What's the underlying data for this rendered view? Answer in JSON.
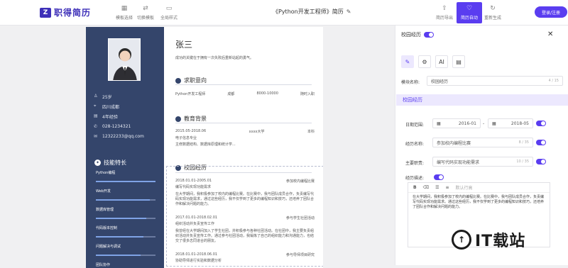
{
  "app": {
    "logo_mark": "Z",
    "logo_text": "职得简历",
    "doc_title": "《Python开发工程师》简历",
    "login": "登录/注册"
  },
  "toolbar": {
    "tools": [
      {
        "icon": "▦",
        "label": "模板选择"
      },
      {
        "icon": "⇄",
        "label": "切换模板"
      },
      {
        "icon": "▭",
        "label": "全局样式"
      }
    ],
    "right": [
      {
        "icon": "⇪",
        "label": "简历导出"
      },
      {
        "icon": "♡",
        "label": "简历自动"
      },
      {
        "icon": "↻",
        "label": "重新生成"
      }
    ]
  },
  "resume": {
    "name": "张三",
    "intro": "成功的关键在于拥有一次失败后重新站起的勇气。",
    "info": [
      {
        "icon": "♙",
        "text": "25岁"
      },
      {
        "icon": "⌖",
        "text": "四川成都"
      },
      {
        "icon": "▤",
        "text": "4年经验"
      },
      {
        "icon": "✆",
        "text": "028-1234321"
      },
      {
        "icon": "✉",
        "text": "12322233@qq.com"
      }
    ],
    "skills_title": "技能特长",
    "skills": [
      {
        "name": "Python编程",
        "level": 1.0
      },
      {
        "name": "Web开发",
        "level": 0.9
      },
      {
        "name": "数据库管理",
        "level": 0.85
      },
      {
        "name": "代码版本控制",
        "level": 0.8
      },
      {
        "name": "问题解决与调试",
        "level": 0.75
      },
      {
        "name": "团队协作",
        "level": 0.7
      }
    ],
    "sections": {
      "intent": {
        "title": "求职意向",
        "items": [
          "Python开发工程师",
          "成都",
          "8000-10000",
          "随时入职"
        ]
      },
      "education": {
        "title": "教育背景",
        "date": "2015.05-2018.06",
        "school": "xxxx大学",
        "degree": "本科",
        "major": "电子信息专业",
        "courses": "主修数据结构、数据库原理和统计学..."
      },
      "campus": {
        "title": "校园经历",
        "entries": [
          {
            "date": "2018.01.01-2005.01",
            "role": "参加校内编程比赛",
            "sub": "编写代码实现功能需求",
            "text": "在大学期间，我积极参加了校内的编程比赛。在比赛中，我与团队成员合作，负责编写代码实现功能需求，通过这些经历，我不仅学到了更多的编程知识和技巧，还培养了团队合作和解决问题的能力。"
          },
          {
            "date": "2017.01.01-2018.02.01",
            "role": "参与学生社团活动",
            "sub": "组织活动并负责宣传工作",
            "text": "我曾经在大学期间加入了学生社团，并积极参与各种社团活动。在社团中，我主要负责组织活动并负责宣传工作。通过参与社团活动，我锻炼了自己的组织能力和沟通能力，也结交了很多志同道合的朋友。"
          },
          {
            "date": "2018.01.01-2018.06.01",
            "role": "参与导师项目研究",
            "sub": "协助导师进行实验和数据分析",
            "text": ""
          }
        ]
      }
    }
  },
  "panel": {
    "title": "校园经历",
    "tabs": [
      {
        "icon": "✎"
      },
      {
        "icon": "⚙"
      },
      {
        "icon": "AI"
      },
      {
        "icon": "▤"
      }
    ],
    "module_name_label": "模块名称:",
    "module_name_value": "校园经历",
    "module_name_count": "4 / 15",
    "band_title": "校园经历",
    "date_label": "日期范围:",
    "date_start": "2016-01",
    "date_sep": "-",
    "date_end": "2018-05",
    "exp_label": "经历名称:",
    "exp_value": "参加校内编程比赛",
    "exp_count": "8 / 35",
    "duty_label": "主要职责:",
    "duty_value": "编写代码实现功能需求",
    "duty_count": "10 / 35",
    "desc_label": "经历描述:",
    "editor_placeholder": "默认行高",
    "editor_text": "在大学期间，我积极参加了校内的编程比赛。在比赛中，我与团队成员合作，负责编写代码实现功能需求。通过这些经历，我不仅学到了更多的编程知识和技巧，还培养了团队合作和解决问题的能力。"
  },
  "watermark": {
    "icon": "↑",
    "text": "IT载站"
  },
  "colors": {
    "accent": "#5a3df0",
    "sidebar": "#34456b"
  }
}
